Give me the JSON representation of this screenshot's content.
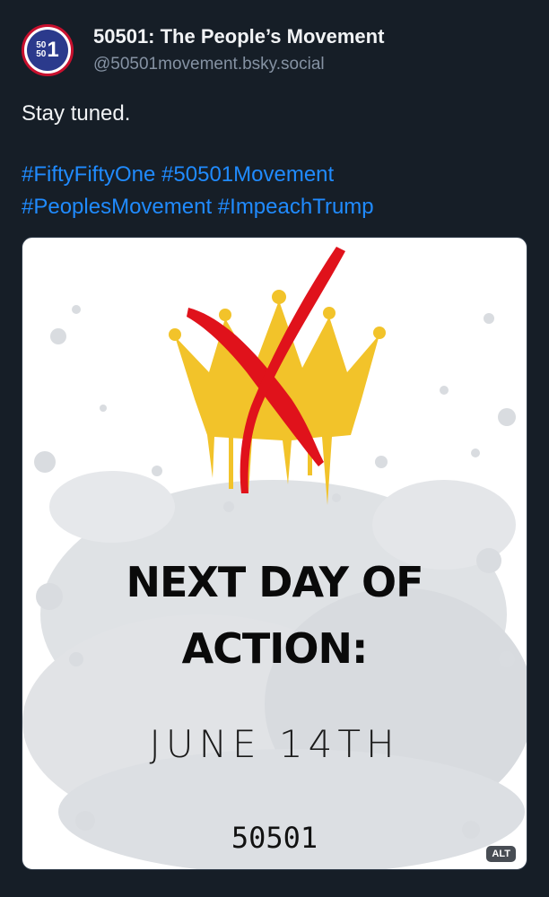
{
  "post": {
    "author": {
      "avatar_line1": "50",
      "avatar_line2": "50",
      "avatar_big": "1",
      "display_name": "50501: The People’s Movement",
      "handle": "@50501movement.bsky.social"
    },
    "text": "Stay tuned.",
    "hashtags": [
      "#FiftyFiftyOne",
      "#50501Movement",
      "#PeoplesMovement",
      "#ImpeachTrump"
    ],
    "image": {
      "headline_line1": "NEXT DAY OF",
      "headline_line2": "ACTION:",
      "date": "JUNE 14TH",
      "org": "50501",
      "alt_badge": "ALT"
    }
  },
  "colors": {
    "background": "#161e27",
    "link": "#208bfe",
    "handle": "#8592a3",
    "crown": "#f2c32a",
    "x_mark": "#e0121b"
  }
}
